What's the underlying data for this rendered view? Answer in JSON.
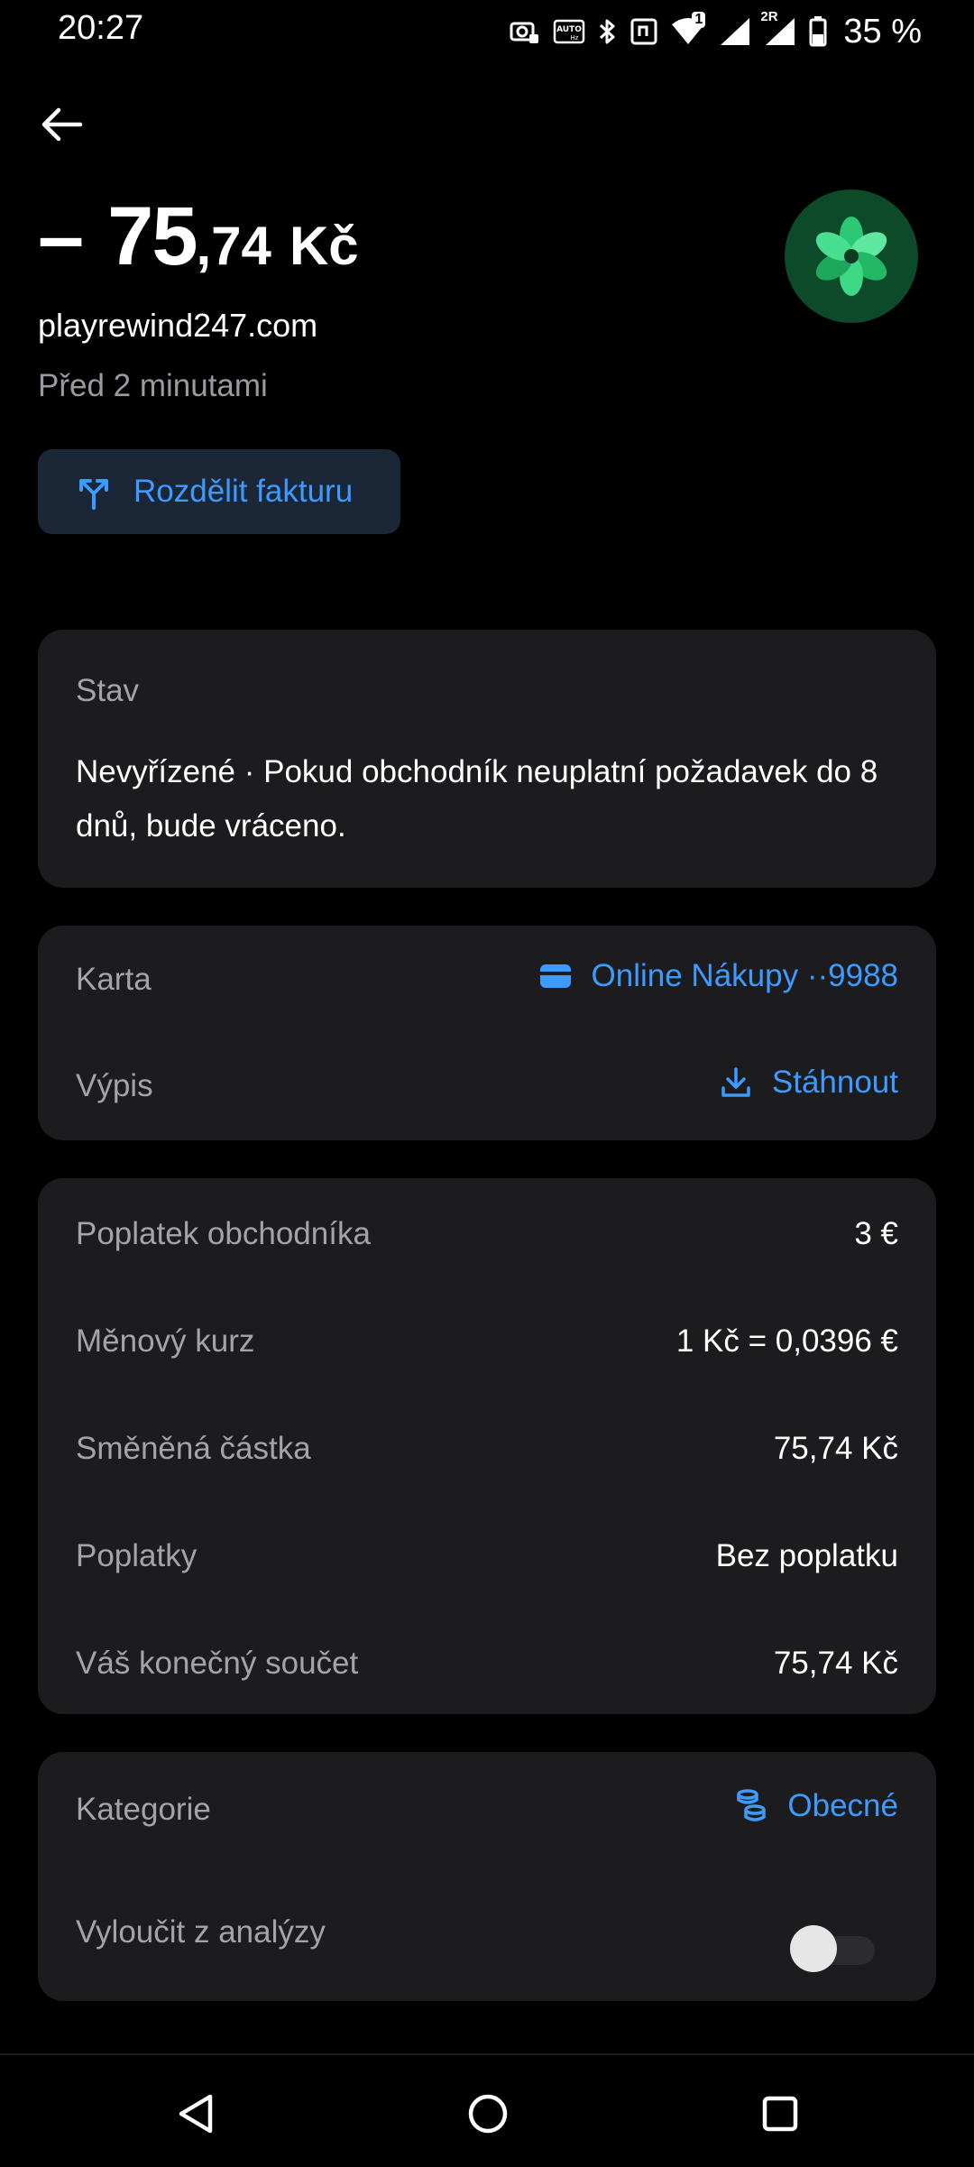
{
  "status_bar": {
    "time": "20:27",
    "battery_percent": "35 %",
    "sim_badge": "1",
    "roaming_badge": "2R",
    "icons": [
      "camera-lock-icon",
      "auto-hz-icon",
      "bluetooth-icon",
      "nfc-icon",
      "wifi-icon",
      "signal-icon",
      "signal-2-icon",
      "battery-icon"
    ]
  },
  "header": {
    "amount_sign": "–",
    "amount_integer": "75",
    "amount_decimal": ",74",
    "currency": "Kč",
    "merchant": "playrewind247.com",
    "timestamp": "Před 2 minutami",
    "split_button_label": "Rozdělit fakturu",
    "logo_color": "#2ecf7a"
  },
  "status_card": {
    "label": "Stav",
    "text": "Nevyřízené · Pokud obchodník neuplatní požadavek do 8 dnů, bude vráceno."
  },
  "card_section": {
    "card_label": "Karta",
    "card_value": "Online Nákupy ··9988",
    "statement_label": "Výpis",
    "statement_action": "Stáhnout"
  },
  "details": [
    {
      "label": "Poplatek obchodníka",
      "value": "3 €"
    },
    {
      "label": "Měnový kurz",
      "value": "1 Kč = 0,0396 €"
    },
    {
      "label": "Směněná částka",
      "value": "75,74 Kč"
    },
    {
      "label": "Poplatky",
      "value": "Bez poplatku"
    },
    {
      "label": "Váš konečný součet",
      "value": "75,74 Kč"
    }
  ],
  "category_section": {
    "category_label": "Kategorie",
    "category_value": "Obecné",
    "exclude_label": "Vyloučit z analýzy",
    "exclude_enabled": false
  },
  "colors": {
    "accent": "#3d9bff",
    "card_bg": "#1c1c1e",
    "muted_text": "#a3a3a8"
  }
}
